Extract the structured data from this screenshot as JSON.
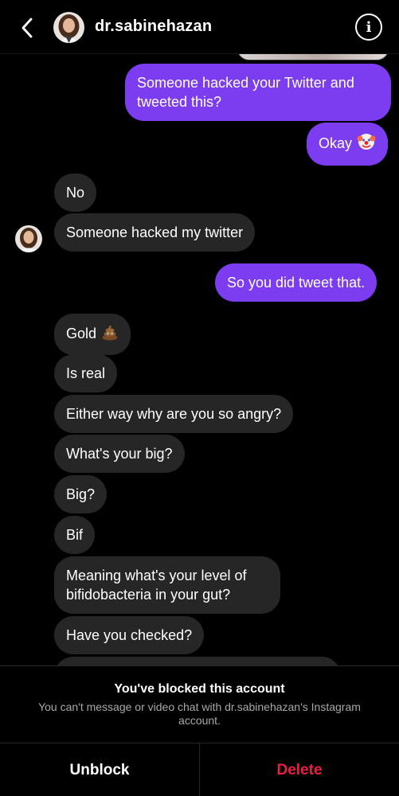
{
  "header": {
    "username": "dr.sabinehazan",
    "back_icon": "chevron-left-icon",
    "info_icon": "info-icon",
    "info_glyph": "i"
  },
  "messages": [
    {
      "side": "out",
      "text": "Someone hacked your Twitter and tweeted this?"
    },
    {
      "side": "out",
      "text": "Okay",
      "emoji": "clown-face-emoji"
    },
    {
      "side": "in",
      "text": "No"
    },
    {
      "side": "in",
      "text": "Someone hacked my twitter"
    },
    {
      "side": "out",
      "text": "So you did tweet that."
    },
    {
      "side": "in",
      "text": "Gold",
      "emoji": "pile-of-poo-emoji"
    },
    {
      "side": "in",
      "text": "Is real"
    },
    {
      "side": "in",
      "text": "Either way why are you so angry?"
    },
    {
      "side": "in",
      "text": "What's your big?"
    },
    {
      "side": "in",
      "text": "Big?"
    },
    {
      "side": "in",
      "text": "Bif"
    },
    {
      "side": "in",
      "text": "Meaning what's your level of bifidobacteria in your gut?"
    },
    {
      "side": "in",
      "text": "Have you checked?"
    }
  ],
  "blocked": {
    "title": "You've blocked this account",
    "description": "You can't message or video chat with dr.sabinehazan's Instagram account.",
    "unblock_label": "Unblock",
    "delete_label": "Delete"
  },
  "colors": {
    "background": "#000000",
    "incoming_bubble": "#262626",
    "outgoing_bubble": "#7c3cf0",
    "delete_red": "#ed1c44",
    "secondary_text": "#a8a8a8"
  }
}
